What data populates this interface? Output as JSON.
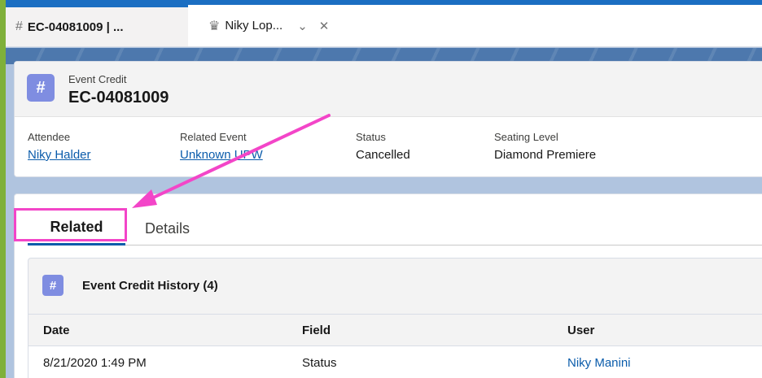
{
  "workspace_tabs": [
    {
      "label": "EC-04081009 | ...",
      "icon": "event-credit-icon"
    },
    {
      "label": "Niky Lop...",
      "icon": "crown-icon"
    }
  ],
  "record": {
    "object_type": "Event Credit",
    "name": "EC-04081009",
    "fields": [
      {
        "label": "Attendee",
        "value": "Niky Halder"
      },
      {
        "label": "Related Event",
        "value": "Unknown UPW"
      },
      {
        "label": "Status",
        "value": "Cancelled"
      },
      {
        "label": "Seating Level",
        "value": "Diamond Premiere"
      }
    ]
  },
  "tabs": {
    "related": "Related",
    "details": "Details"
  },
  "related_list": {
    "title": "Event Credit History (4)",
    "columns": [
      "Date",
      "Field",
      "User"
    ],
    "rows": [
      {
        "date": "8/21/2020 1:49 PM",
        "field": "Status",
        "user": "Niky Manini"
      }
    ]
  },
  "colors": {
    "brand_blue": "#1b6ec2",
    "link": "#0b5cab",
    "object_icon": "#7f8de1",
    "annotation": "#f345c8"
  }
}
